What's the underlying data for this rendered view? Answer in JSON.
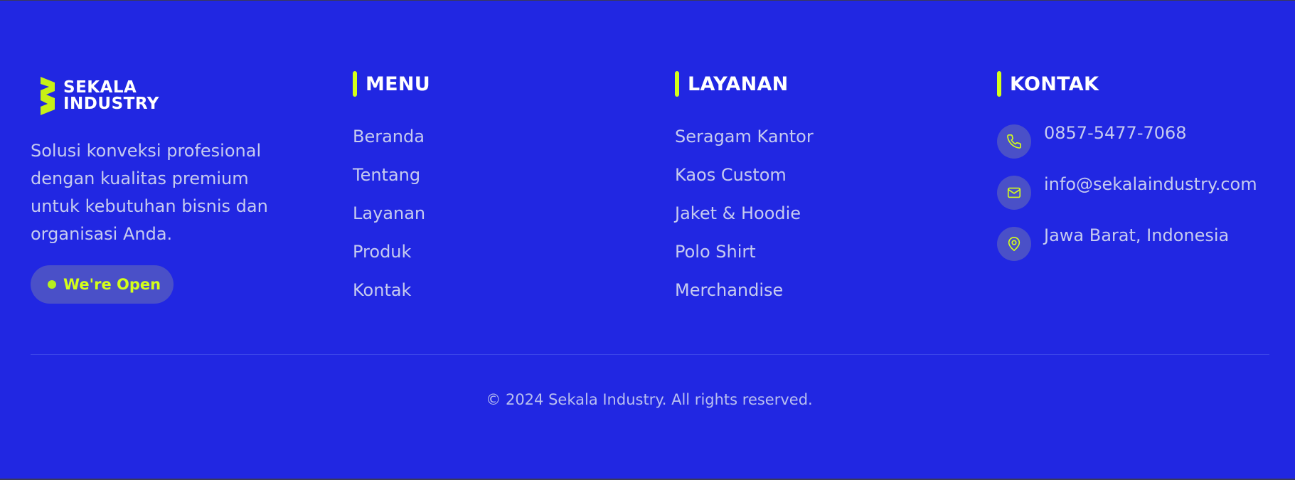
{
  "brand": {
    "logo_line1": "SEKALA",
    "logo_line2": "INDUSTRY",
    "description": "Solusi konveksi profesional dengan kualitas premium untuk kebutuhan bisnis dan organisasi Anda.",
    "status_label": "We're Open"
  },
  "menu": {
    "heading": "MENU",
    "items": [
      "Beranda",
      "Tentang",
      "Layanan",
      "Produk",
      "Kontak"
    ]
  },
  "layanan": {
    "heading": "LAYANAN",
    "items": [
      "Seragam Kantor",
      "Kaos Custom",
      "Jaket & Hoodie",
      "Polo Shirt",
      "Merchandise"
    ]
  },
  "kontak": {
    "heading": "KONTAK",
    "phone": "0857-5477-7068",
    "email": "info@sekalaindustry.com",
    "address": "Jawa Barat, Indonesia"
  },
  "copyright": "© 2024 Sekala Industry. All rights reserved.",
  "icons": {
    "phone": "phone-icon",
    "email": "mail-icon",
    "address": "map-pin-icon"
  },
  "colors": {
    "background": "#2127e2",
    "accent": "#d4ff19",
    "text": "#c6cbef",
    "heading": "#ffffff"
  }
}
